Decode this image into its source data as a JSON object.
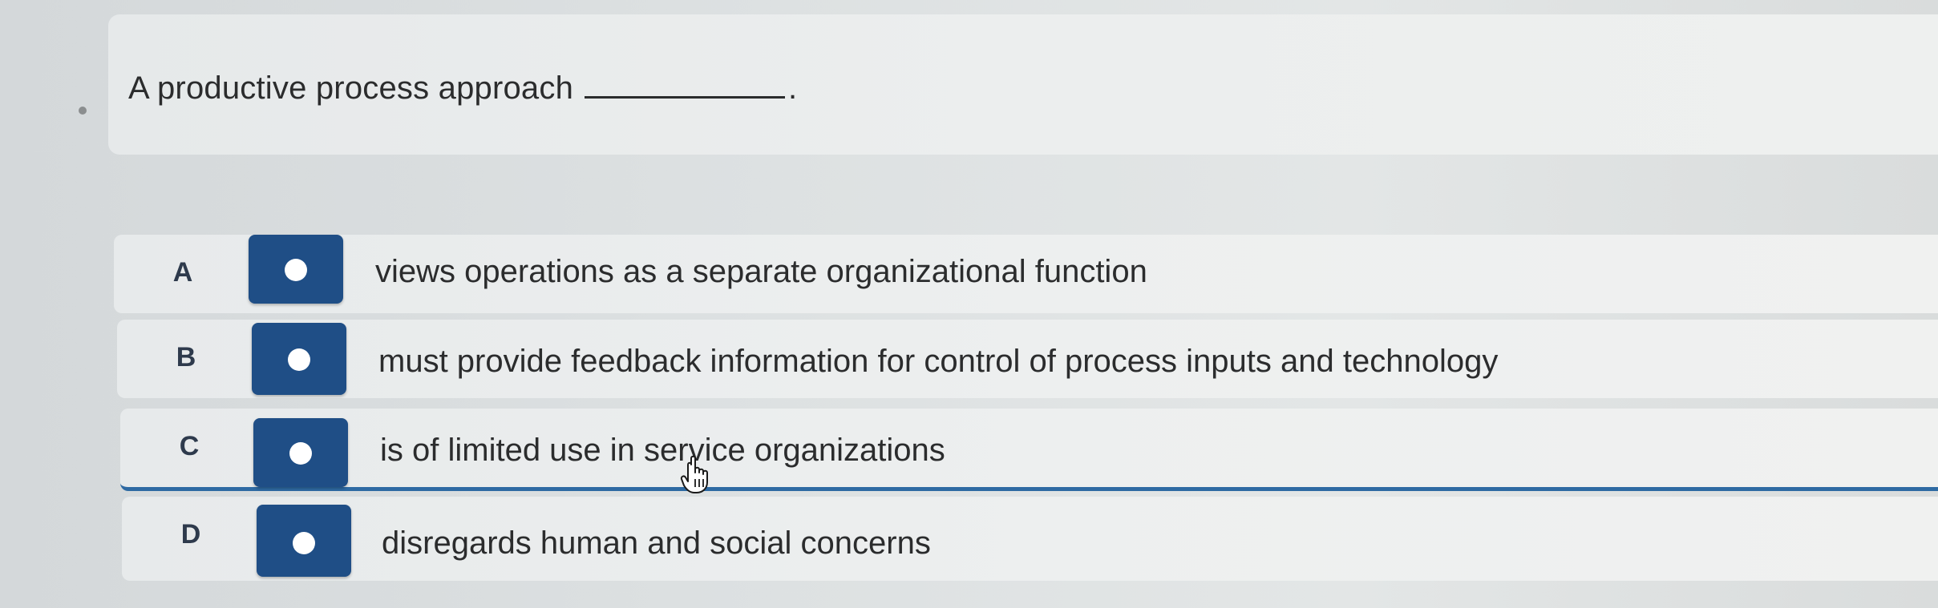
{
  "question": {
    "text": "A productive process approach",
    "blank_suffix": "."
  },
  "answers": [
    {
      "letter": "A",
      "text": "views operations as a separate organizational function"
    },
    {
      "letter": "B",
      "text": "must provide feedback information for control of process inputs and technology"
    },
    {
      "letter": "C",
      "text": "is of limited use in service organizations"
    },
    {
      "letter": "D",
      "text": "disregards human and social concerns"
    }
  ],
  "colors": {
    "radio_fill": "#1f4e86",
    "selected_underline": "#2e6aa3",
    "text": "#2b2c2d"
  },
  "icons": {
    "radio": "radio-button-icon",
    "cursor": "hand-pointer-icon"
  }
}
